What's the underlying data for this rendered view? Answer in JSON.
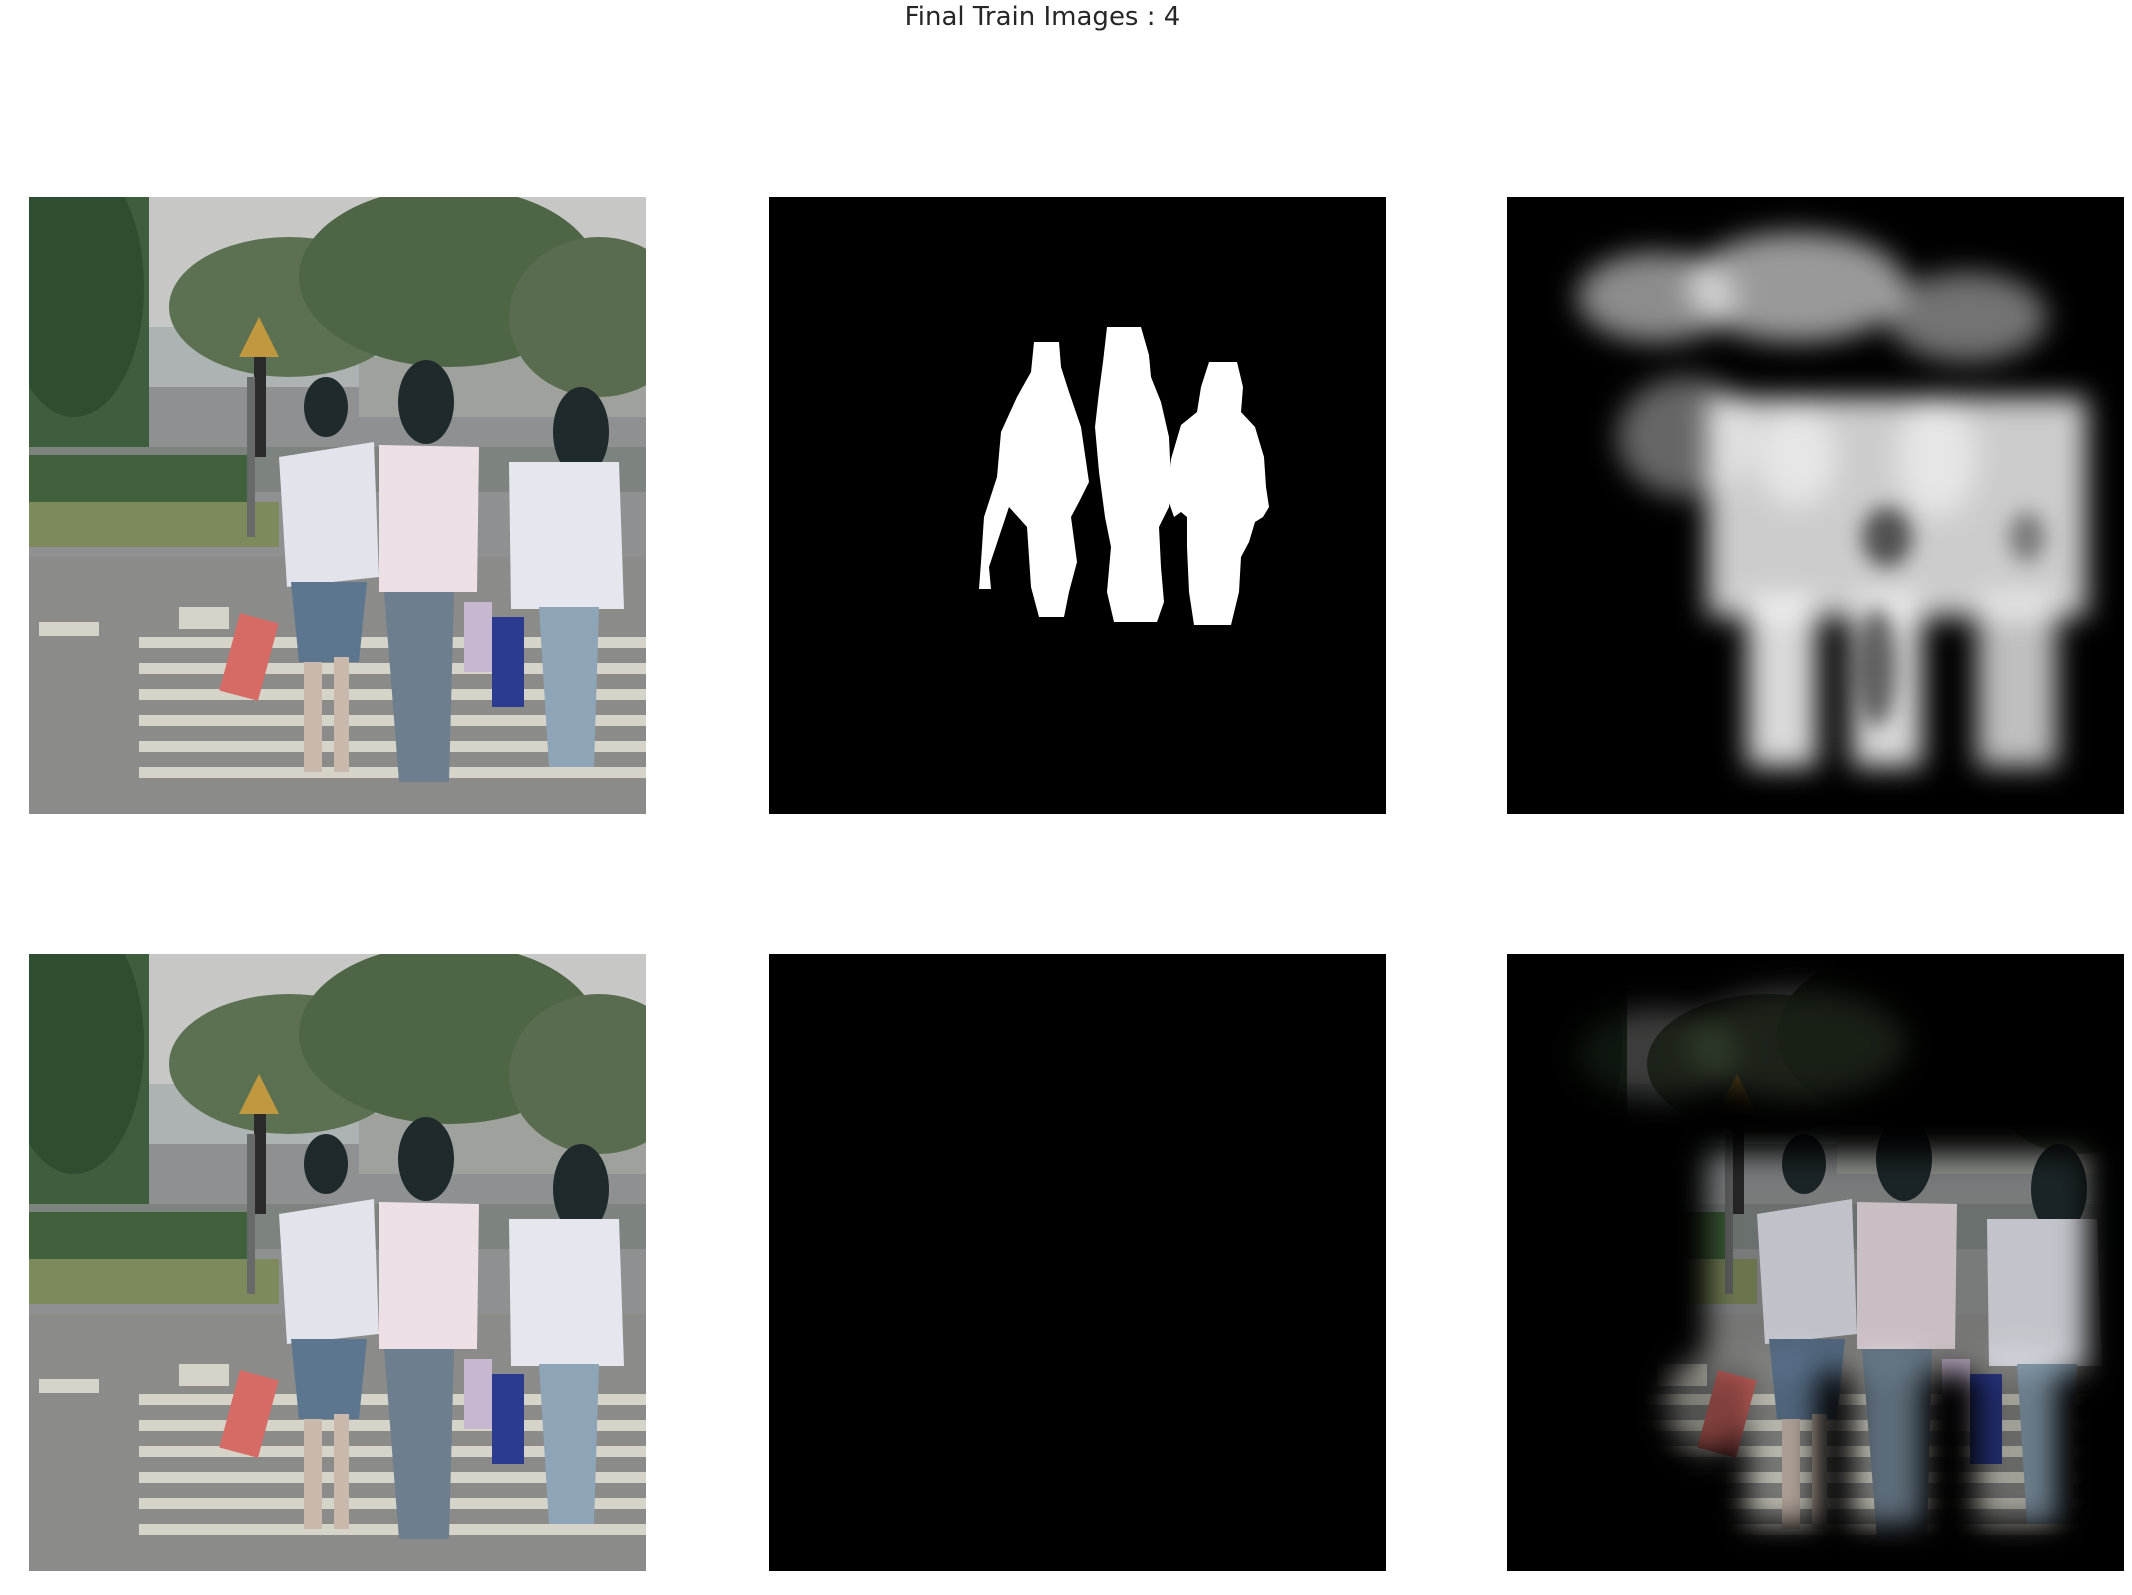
{
  "figure": {
    "title": "Final Train Images : 4"
  },
  "panels": [
    {
      "row": 1,
      "col": 1,
      "content": "input photo"
    },
    {
      "row": 1,
      "col": 2,
      "content": "ground-truth mask"
    },
    {
      "row": 1,
      "col": 3,
      "content": "predicted mask"
    },
    {
      "row": 2,
      "col": 1,
      "content": "input photo"
    },
    {
      "row": 2,
      "col": 2,
      "content": "photo masked by ground truth"
    },
    {
      "row": 2,
      "col": 3,
      "content": "photo masked by prediction"
    }
  ],
  "colors": {
    "background": "#ffffff",
    "title_text": "#262626",
    "mask_bg": "#000000",
    "mask_fg": "#ffffff"
  }
}
